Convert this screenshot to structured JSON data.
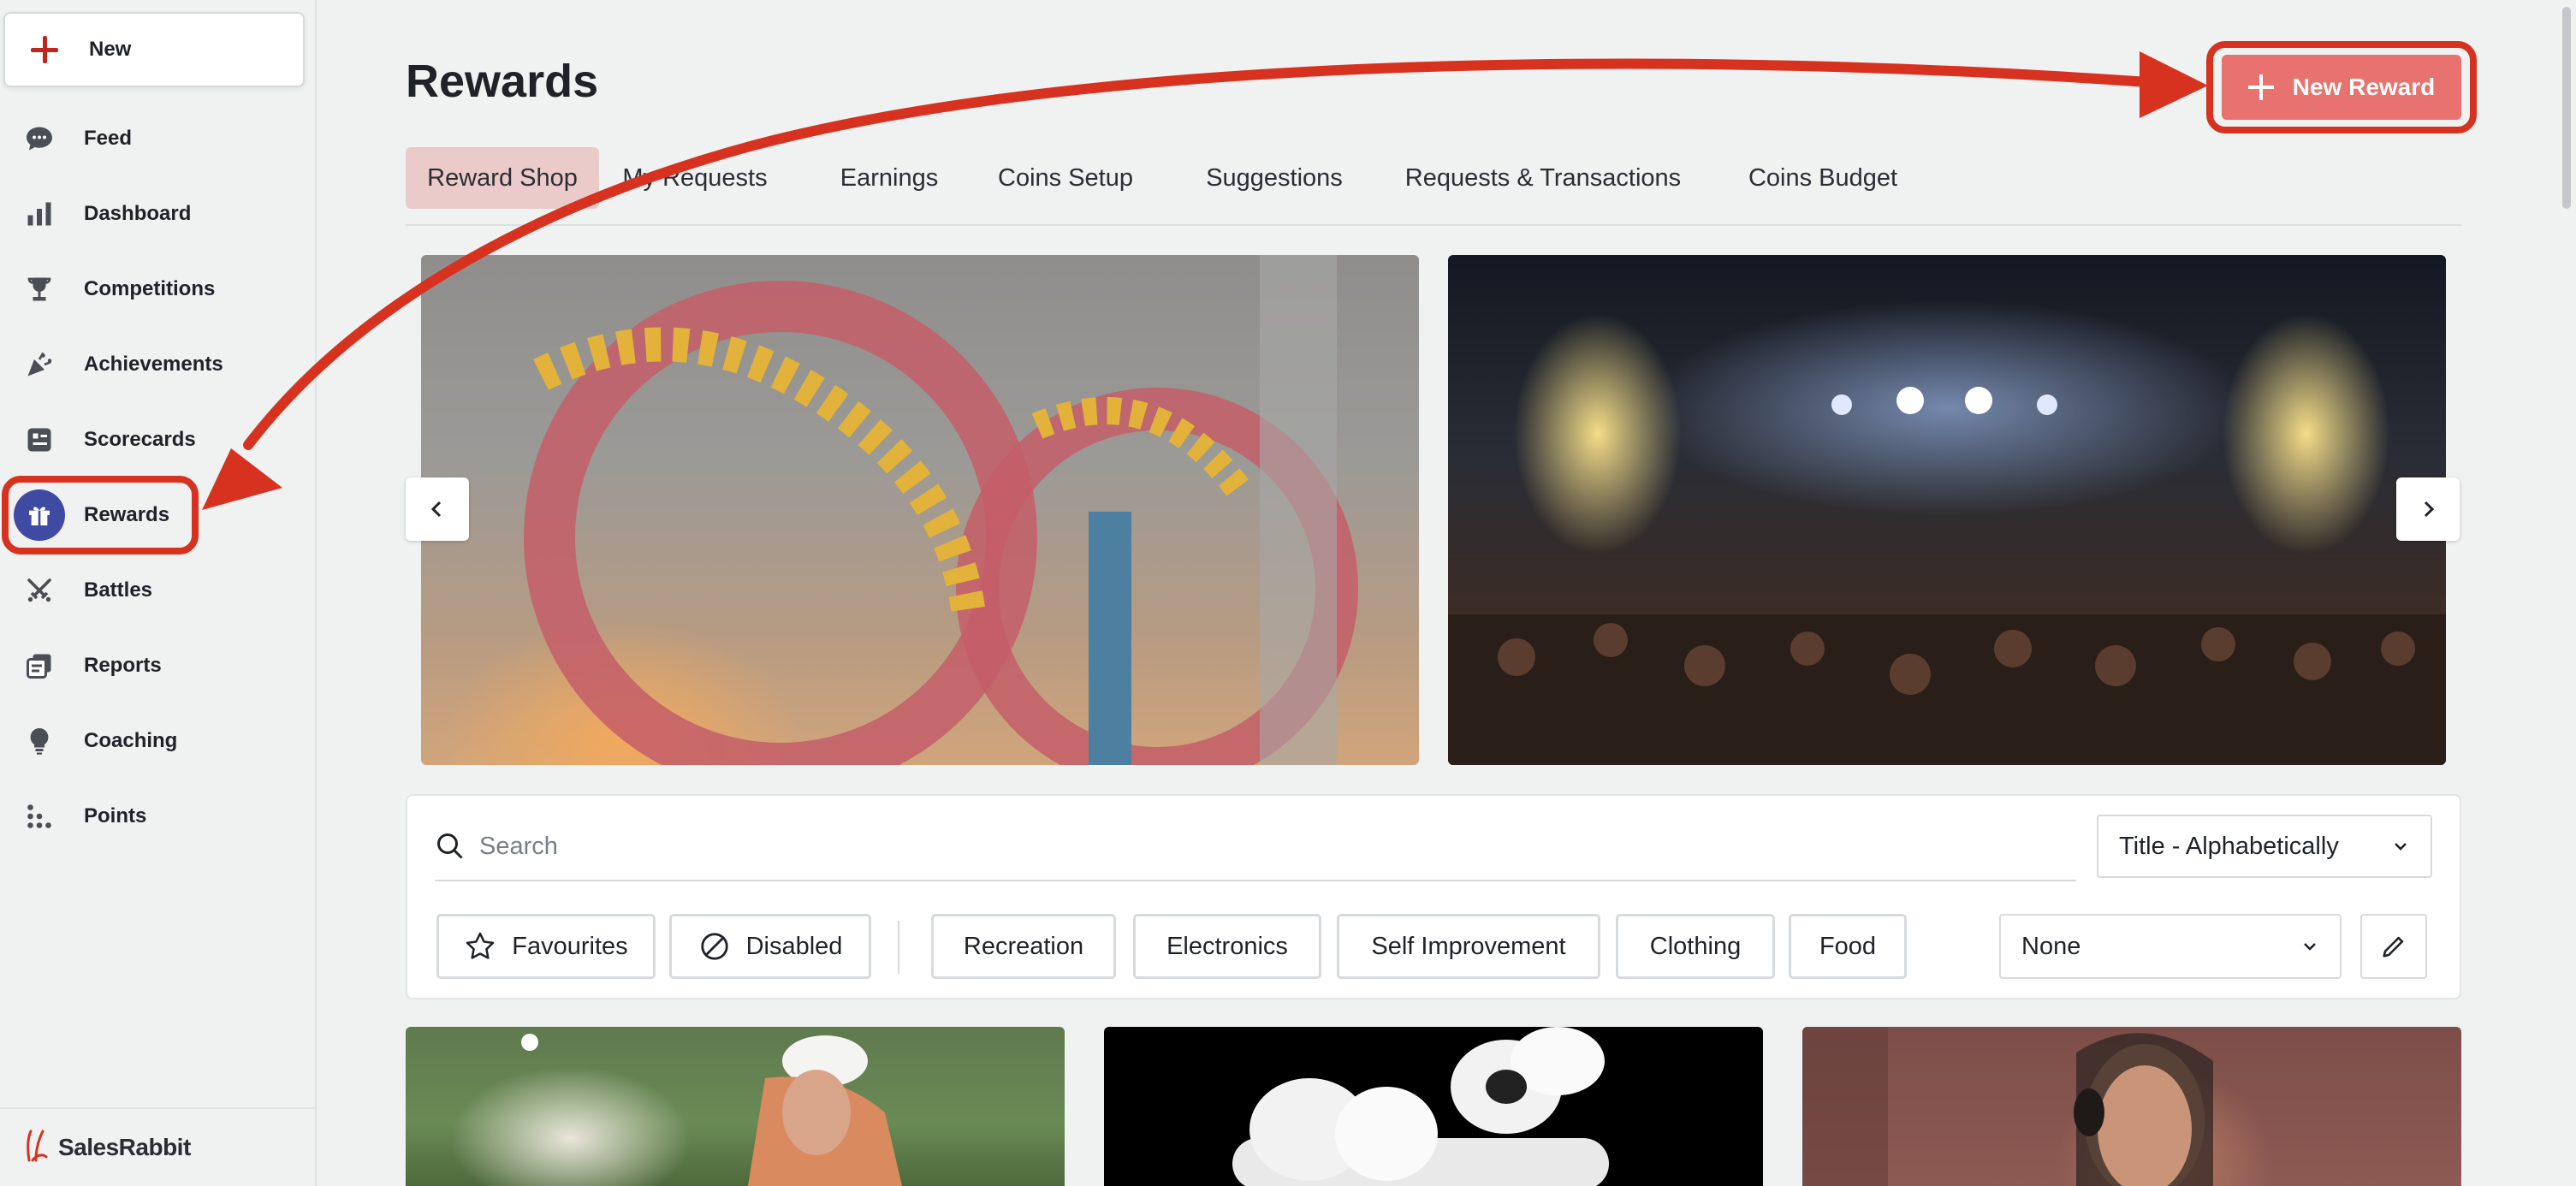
{
  "sidebar": {
    "new_label": "New",
    "items": [
      {
        "label": "Feed",
        "icon": "chat-bubble-icon"
      },
      {
        "label": "Dashboard",
        "icon": "bar-chart-icon"
      },
      {
        "label": "Competitions",
        "icon": "trophy-icon"
      },
      {
        "label": "Achievements",
        "icon": "confetti-icon"
      },
      {
        "label": "Scorecards",
        "icon": "scorecard-icon"
      },
      {
        "label": "Rewards",
        "icon": "gift-icon",
        "active": true
      },
      {
        "label": "Battles",
        "icon": "crossed-swords-icon"
      },
      {
        "label": "Reports",
        "icon": "reports-icon"
      },
      {
        "label": "Coaching",
        "icon": "lightbulb-icon"
      },
      {
        "label": "Points",
        "icon": "dots-grid-icon"
      }
    ],
    "brand": "SalesRabbit"
  },
  "header": {
    "title": "Rewards",
    "new_reward_label": "New Reward"
  },
  "tabs": [
    {
      "label": "Reward Shop",
      "active": true
    },
    {
      "label": "My Requests"
    },
    {
      "label": "Earnings"
    },
    {
      "label": "Coins Setup"
    },
    {
      "label": "Suggestions"
    },
    {
      "label": "Requests & Transactions"
    },
    {
      "label": "Coins Budget"
    }
  ],
  "search": {
    "placeholder": "Search",
    "value": ""
  },
  "sort": {
    "selected": "Title - Alphabetically"
  },
  "filters": {
    "favourites": "Favourites",
    "disabled": "Disabled",
    "categories": [
      "Recreation",
      "Electronics",
      "Self Improvement",
      "Clothing",
      "Food"
    ],
    "group_select": "None"
  },
  "colors": {
    "accent": "#e7726f",
    "annotation_red": "#d7321f",
    "active_tab_bg": "#ebcaca",
    "active_nav_icon_bg": "#3f4ba3"
  }
}
